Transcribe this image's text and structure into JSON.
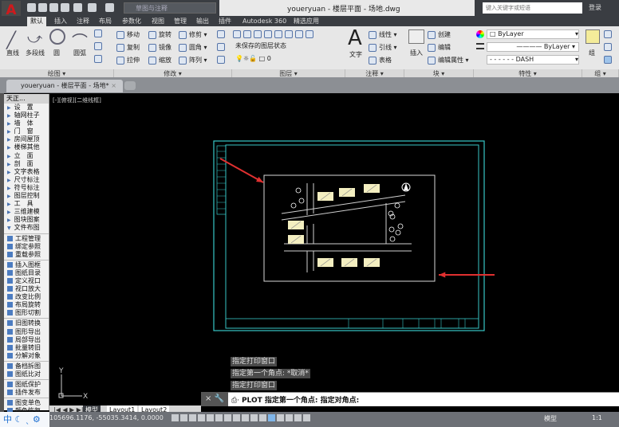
{
  "app": {
    "title": "youeryuan - 楼层平面 - 场地.dwg",
    "workspace": "草图与注释",
    "search_placeholder": "键入关键字或短语",
    "login": "登录"
  },
  "ribbon_tabs": [
    "默认",
    "插入",
    "注释",
    "布局",
    "参数化",
    "视图",
    "管理",
    "输出",
    "插件",
    "Autodesk 360",
    "精选应用"
  ],
  "draw_panel": {
    "label": "绘图",
    "items": [
      "直线",
      "多段线",
      "圆",
      "圆弧"
    ]
  },
  "modify_panel": {
    "label": "修改",
    "items": [
      "移动",
      "旋转",
      "修剪",
      "复制",
      "镜像",
      "圆角",
      "拉伸",
      "缩放",
      "阵列"
    ]
  },
  "layer_panel": {
    "label": "图层",
    "layer_state": "未保存的图层状态",
    "current_layer": "0"
  },
  "annot_panel": {
    "label": "注释",
    "text": "文字",
    "items": [
      "线性",
      "引线",
      "表格"
    ]
  },
  "block_panel": {
    "label": "块",
    "insert": "插入",
    "items": [
      "创建",
      "编辑",
      "编辑属性"
    ]
  },
  "props_panel": {
    "label": "特性",
    "color": "ByLayer",
    "lineweight": "ByLayer",
    "linetype": "DASH"
  },
  "group_panel": {
    "label": "组",
    "group": "组"
  },
  "doc_tab": "youeryuan - 楼层平面 - 场地*",
  "palette": {
    "title": "天正...",
    "groups": [
      [
        "设　置",
        "轴网柱子",
        "墙　体",
        "门　窗",
        "房间屋顶",
        "楼梯其他",
        "立　面",
        "剖　面",
        "文字表格",
        "尺寸标注",
        "符号标注",
        "图层控制",
        "工　具",
        "三维建模",
        "图块图案",
        "文件布图"
      ],
      [
        "工程管理",
        "绑定参照",
        "重载参照"
      ],
      [
        "插入图框",
        "图纸目录",
        "定义视口",
        "视口放大",
        "改变比例",
        "布局旋转",
        "图形切割"
      ],
      [
        "旧图转换",
        "图形导出",
        "局部导出",
        "批量转旧",
        "分解对象"
      ],
      [
        "备档拆图",
        "图纸比对"
      ],
      [
        "图纸保护",
        "插件发布"
      ],
      [
        "图变单色",
        "颜色恢复",
        "图形变线"
      ]
    ]
  },
  "viewport_label": "[-][俯视][二维线框]",
  "command_history": [
    "指定打印窗口",
    "指定第一个角点: *取消*",
    "指定打印窗口"
  ],
  "command_line": "PLOT 指定第一个角点: 指定对角点:",
  "layout_tabs": [
    "模型",
    "Layout1",
    "Layout2"
  ],
  "status": {
    "coords": "105696.1176,  -55035.3414, 0.0000",
    "model": "模型",
    "scale": "1:1"
  },
  "ime": "中",
  "colors": {
    "frame": "#37c6c6",
    "arrow": "#e03030",
    "building": "#f3eec0",
    "canvas": "#000000"
  }
}
